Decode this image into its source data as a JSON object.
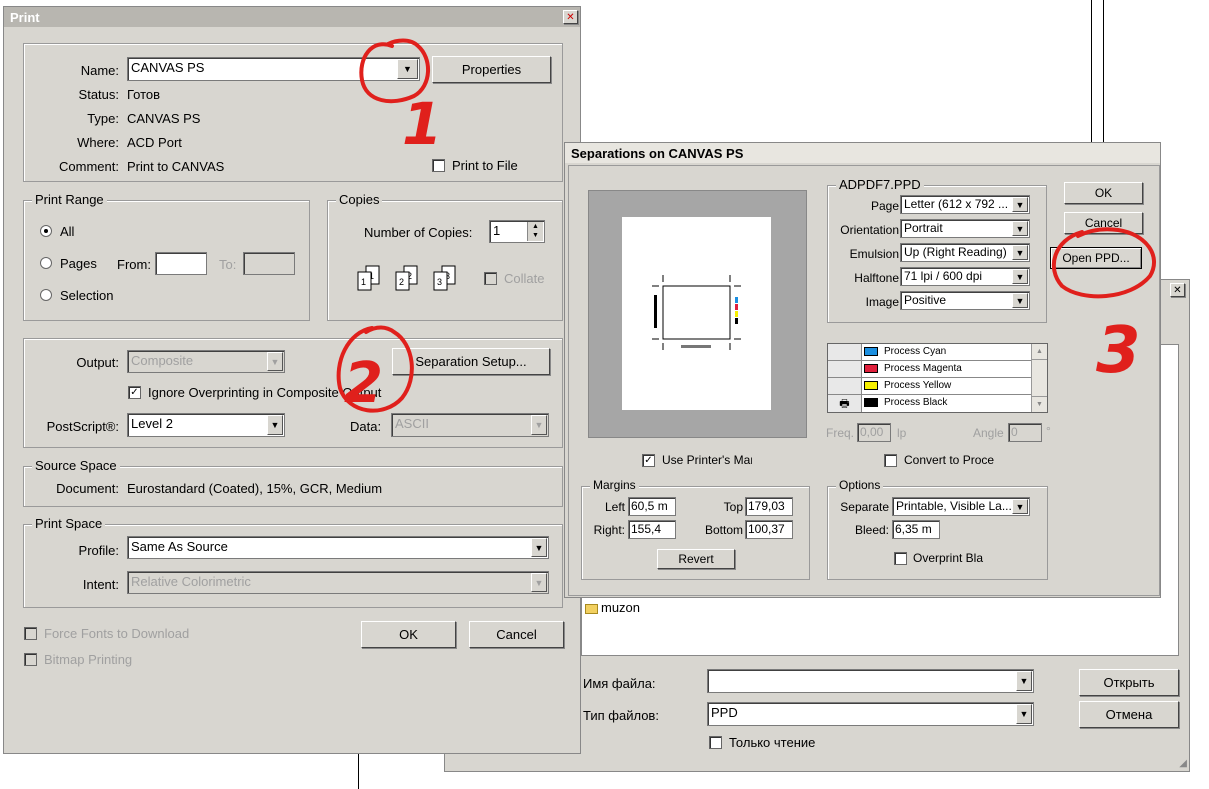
{
  "print": {
    "title": "Print",
    "printer": {
      "name_label": "Name:",
      "name_value": "CANVAS PS",
      "properties_btn": "Properties",
      "status_label": "Status:",
      "status_value": "Готов",
      "type_label": "Type:",
      "type_value": "CANVAS PS",
      "where_label": "Where:",
      "where_value": "ACD Port",
      "comment_label": "Comment:",
      "comment_value": "Print to CANVAS",
      "print_to_file": "Print to File"
    },
    "range": {
      "title": "Print Range",
      "all": "All",
      "pages": "Pages",
      "from": "From:",
      "to": "To:",
      "selection": "Selection"
    },
    "copies": {
      "title": "Copies",
      "number_label": "Number of Copies:",
      "number_value": "1",
      "collate": "Collate"
    },
    "output": {
      "output_label": "Output:",
      "output_value": "Composite",
      "sep_setup_btn": "Separation Setup...",
      "ignore_overprint": "Ignore Overprinting in Composite Output",
      "postscript_label": "PostScript®:",
      "postscript_value": "Level 2",
      "data_label": "Data:",
      "data_value": "ASCII"
    },
    "source": {
      "title": "Source Space",
      "doc_label": "Document:",
      "doc_value": "Eurostandard (Coated), 15%, GCR, Medium"
    },
    "print_space": {
      "title": "Print Space",
      "profile_label": "Profile:",
      "profile_value": "Same As Source",
      "intent_label": "Intent:",
      "intent_value": "Relative Colorimetric"
    },
    "force_fonts": "Force Fonts to Download",
    "bitmap_printing": "Bitmap Printing",
    "ok": "OK",
    "cancel": "Cancel"
  },
  "sep": {
    "title": "Separations on CANVAS PS",
    "ppd_group": "ADPDF7.PPD",
    "page_label": "Page",
    "page_value": "Letter (612 x 792 ...",
    "orient_label": "Orientation",
    "orient_value": "Portrait",
    "emulsion_label": "Emulsion",
    "emulsion_value": "Up (Right Reading)",
    "halftone_label": "Halftone",
    "halftone_value": "71 lpi / 600 dpi",
    "image_label": "Image",
    "image_value": "Positive",
    "inks": [
      {
        "name": "Process Cyan",
        "color": "#1c8fe0",
        "printer": ""
      },
      {
        "name": "Process Magenta",
        "color": "#e0203c",
        "printer": ""
      },
      {
        "name": "Process Yellow",
        "color": "#f7f000",
        "printer": ""
      },
      {
        "name": "Process Black",
        "color": "#000000",
        "printer": "🖶"
      }
    ],
    "freq_label": "Freq.",
    "freq_value": "0,00",
    "freq_unit": "lp",
    "angle_label": "Angle",
    "angle_value": "0",
    "angle_unit": "°",
    "use_printers_marks": "Use Printer's Mar",
    "convert_to_process": "Convert to Proce",
    "margins_title": "Margins",
    "left_label": "Left",
    "left_value": "60,5 m",
    "top_label": "Top",
    "top_value": "179,03",
    "right_label": "Right:",
    "right_value": "155,4",
    "bottom_label": "Bottom",
    "bottom_value": "100,37",
    "revert_btn": "Revert",
    "options_title": "Options",
    "separate_label": "Separate",
    "separate_value": "Printable, Visible La...",
    "bleed_label": "Bleed:",
    "bleed_value": "6,35 m",
    "overprint_black": "Overprint Bla",
    "ok": "OK",
    "cancel": "Cancel",
    "open_ppd": "Open PPD..."
  },
  "open_dialog": {
    "folder": "muzon",
    "filename_label": "Имя файла:",
    "filename_value": "",
    "filetype_label": "Тип файлов:",
    "filetype_value": "PPD",
    "readonly": "Только чтение",
    "open_btn": "Открыть",
    "cancel_btn": "Отмена"
  },
  "annotations": {
    "n1": "1",
    "n2": "2",
    "n3": "3",
    "color": "#e0201c"
  }
}
